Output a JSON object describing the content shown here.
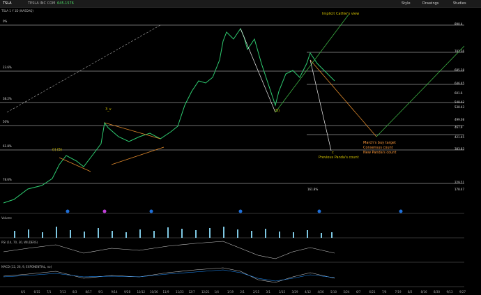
{
  "toolbar": {
    "symbol": "TSLA",
    "company": "TESLA INC COM",
    "price": "645.1576",
    "right_items": [
      "Style",
      "Drawings",
      "Studies"
    ],
    "title": "TSLA 1 Y 1D (NASDAQ)"
  },
  "price_levels": [
    {
      "price": "890.4",
      "label": "0%"
    },
    {
      "price": "782.36",
      "label": ""
    },
    {
      "price": "685.28",
      "label": "23.6%"
    },
    {
      "price": "646.45",
      "label": ""
    },
    {
      "price": "601.6",
      "label": ""
    },
    {
      "price": "548.42",
      "label": ""
    },
    {
      "price": "538.43",
      "label": "38.2%"
    },
    {
      "price": "499.08",
      "label": ""
    },
    {
      "price": "467.9",
      "label": ""
    },
    {
      "price": "421.45",
      "label": "50%"
    },
    {
      "price": "383.83",
      "label": "61.8%"
    },
    {
      "price": "229.51",
      "label": "78.6%"
    },
    {
      "price": "178.47",
      "label": "161.8%"
    }
  ],
  "annotations": {
    "cathie": "Implicit Cathie's view",
    "march_target": "March's buy target",
    "consensus": "Consensus count",
    "new_panda": "New Panda's count",
    "previous_panda": "Previous Panda's count",
    "wave_3v": "3_v",
    "wave_5": "(5)",
    "wave_ib": "(i) (5)",
    "c_label": "c"
  },
  "panels": {
    "volume": "Volume",
    "rsi": "RSI (14, 70, 30, WILDERS)",
    "macd": "MACD (12, 26, 9, EXPONENTIAL, no)"
  },
  "x_axis": [
    "6/1",
    "6/15",
    "7/1",
    "7/13",
    "8/3",
    "8/17",
    "9/1",
    "9/14",
    "9/28",
    "10/12",
    "10/26",
    "11/9",
    "11/23",
    "12/7",
    "12/21",
    "1/4",
    "1/19",
    "2/1",
    "2/15",
    "3/1",
    "3/15",
    "3/29",
    "4/12",
    "4/26",
    "5/10",
    "5/24",
    "6/7",
    "6/21",
    "7/6",
    "7/19",
    "8/2",
    "8/16",
    "8/30",
    "9/13",
    "9/27"
  ]
}
